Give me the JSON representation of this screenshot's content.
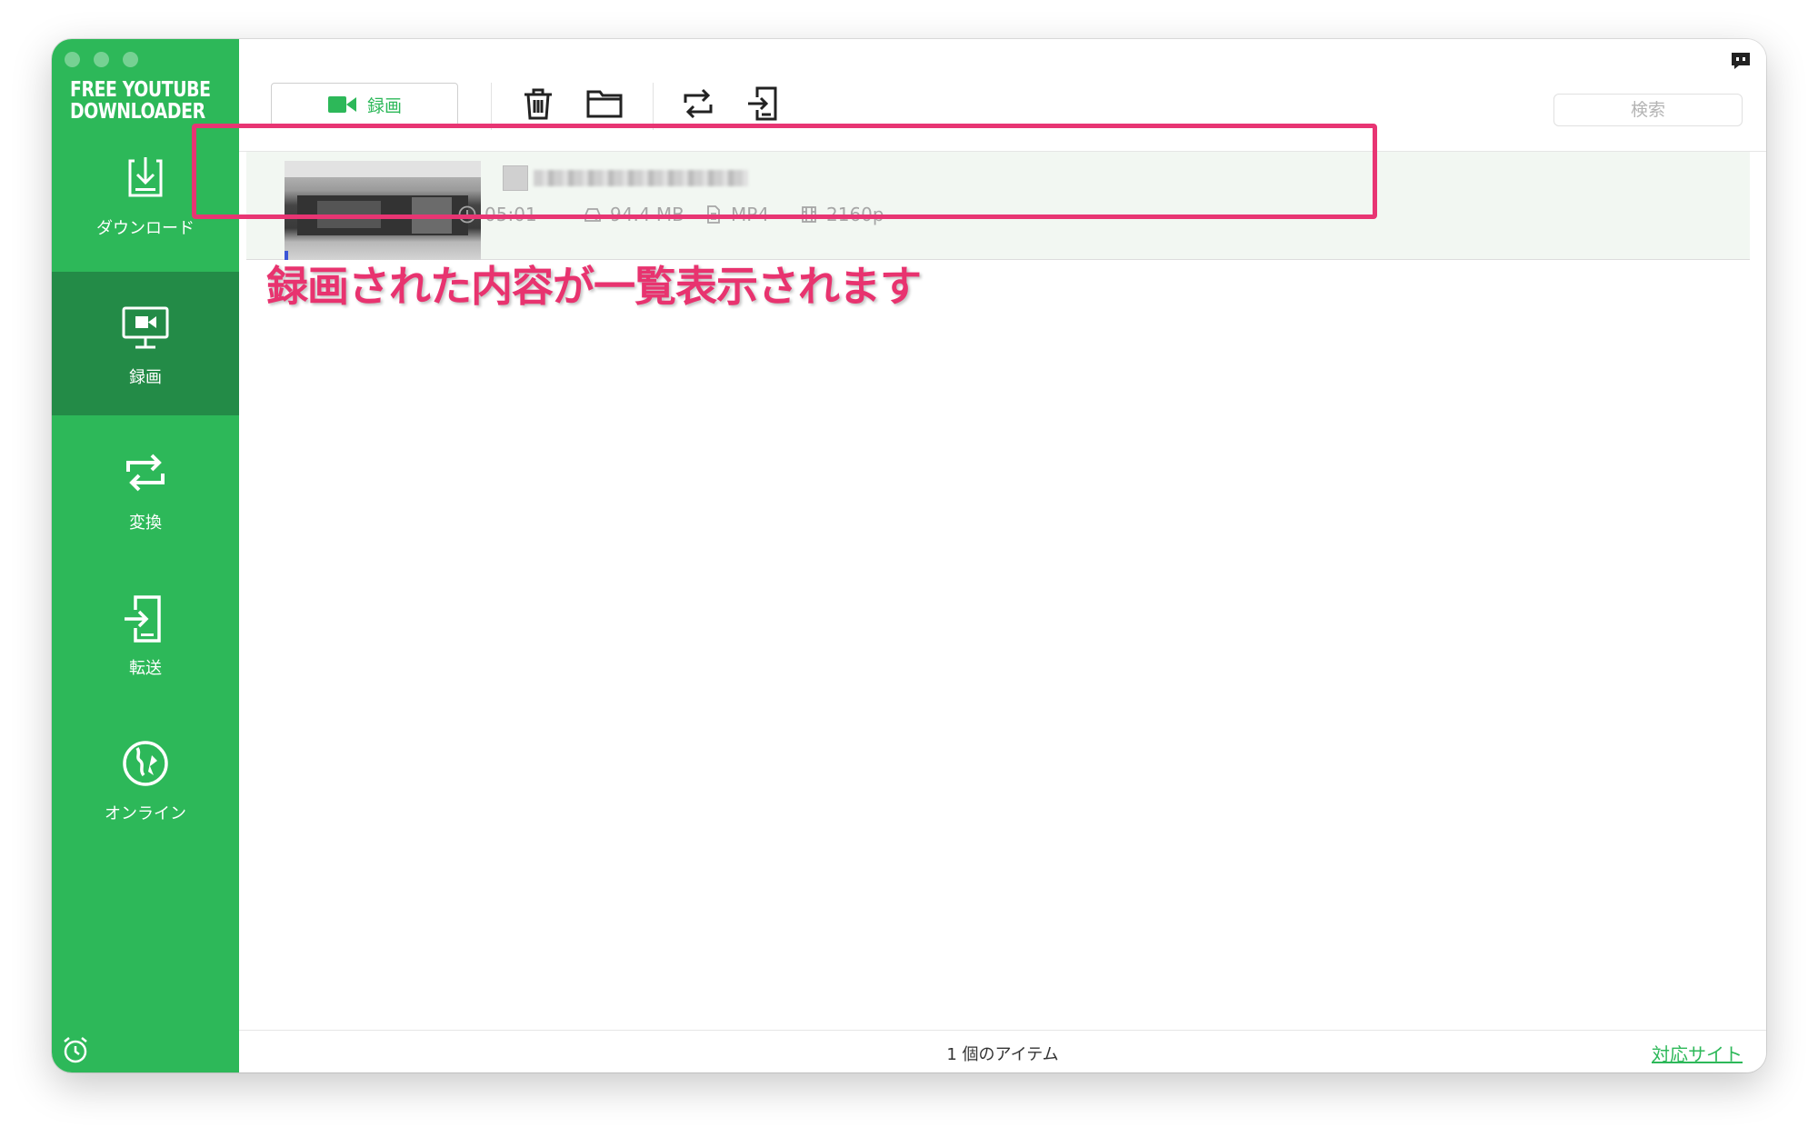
{
  "app": {
    "brand_line1": "FREE YOUTUBE",
    "brand_line2": "DOWNLOADER"
  },
  "sidebar": {
    "items": [
      {
        "label": "ダウンロード",
        "icon": "download-icon"
      },
      {
        "label": "録画",
        "icon": "screen-record-icon",
        "active": true
      },
      {
        "label": "変換",
        "icon": "convert-icon"
      },
      {
        "label": "転送",
        "icon": "transfer-icon"
      },
      {
        "label": "オンライン",
        "icon": "online-globe-icon"
      }
    ],
    "footer_icon": "alarm-clock-icon"
  },
  "toolbar": {
    "record_label": "録画",
    "record_icon": "video-camera-icon",
    "icons": [
      "trash-icon",
      "folder-icon",
      "convert-icon",
      "transfer-icon"
    ],
    "search_placeholder": "検索",
    "top_right_icon": "feedback-icon"
  },
  "list": {
    "items": [
      {
        "duration": "05:01",
        "size": "94.4 MB",
        "format": "MP4",
        "resolution": "2160p"
      }
    ]
  },
  "annotation": "録画された内容が一覧表示されます",
  "status": {
    "count_text": "1 個のアイテム",
    "link_text": "対応サイト"
  },
  "colors": {
    "accent": "#2db859",
    "sidebar_active": "#238b47",
    "highlight": "#e83573"
  }
}
